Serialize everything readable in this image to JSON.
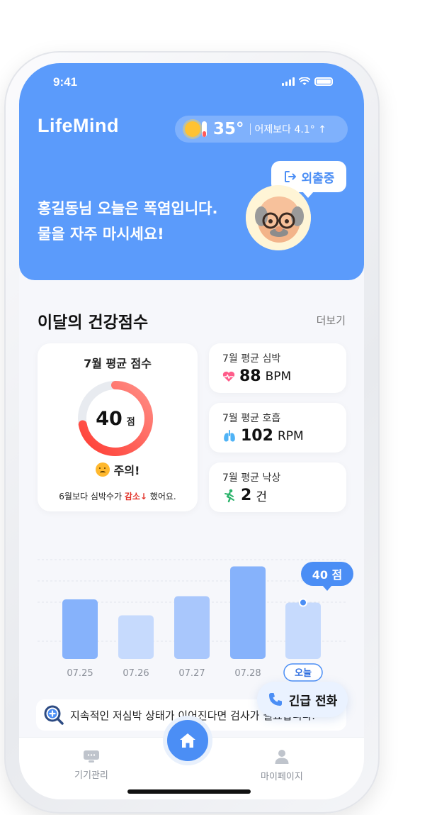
{
  "status_bar": {
    "time": "9:41"
  },
  "header": {
    "logo": "LifeMind",
    "weather": {
      "temp": "35°",
      "diff": "어제보다 4.1° ↑",
      "icon": "sun-thermometer-icon"
    },
    "outing_badge": "외출중",
    "greeting_line1": "홍길동님 오늘은 폭염입니다.",
    "greeting_line2": "물을 자주 마시세요!"
  },
  "section": {
    "title": "이달의 건강점수",
    "more": "더보기"
  },
  "score_card": {
    "title": "7월 평균 점수",
    "score": "40",
    "unit": "점",
    "score_fraction": 0.72,
    "status": "주의!",
    "note_prefix": "6월보다 심박수가",
    "note_highlight": "감소↓",
    "note_suffix": "했어요."
  },
  "metrics": [
    {
      "label": "7월 평균 심박",
      "value": "88",
      "unit": "BPM",
      "icon": "heart-icon",
      "color": "#ff5c8a"
    },
    {
      "label": "7월 평균 호흡",
      "value": "102",
      "unit": "RPM",
      "icon": "lungs-icon",
      "color": "#4fb3f6"
    },
    {
      "label": "7월 평균 낙상",
      "value": "2",
      "unit": "건",
      "icon": "fall-icon",
      "color": "#2bb36b"
    }
  ],
  "chart_data": {
    "type": "bar",
    "categories": [
      "07.25",
      "07.26",
      "07.27",
      "07.28",
      "오늘"
    ],
    "values": [
      56,
      41,
      59,
      87,
      53
    ],
    "highlight_label": "40 점",
    "colors": [
      "#86b2fb",
      "#c6dafd",
      "#a9c7fc",
      "#86b2fb",
      "#c6dafd"
    ]
  },
  "emergency_button": "긴급 전화",
  "info_message": "지속적인 저심박 상태가 이어진다면 검사가 필요합니다.",
  "nav": {
    "devices": "기기관리",
    "mypage": "마이페이지"
  },
  "colors": {
    "primary": "#5b9bfb",
    "accent": "#4b8ef5",
    "warning": "#e2342b"
  }
}
